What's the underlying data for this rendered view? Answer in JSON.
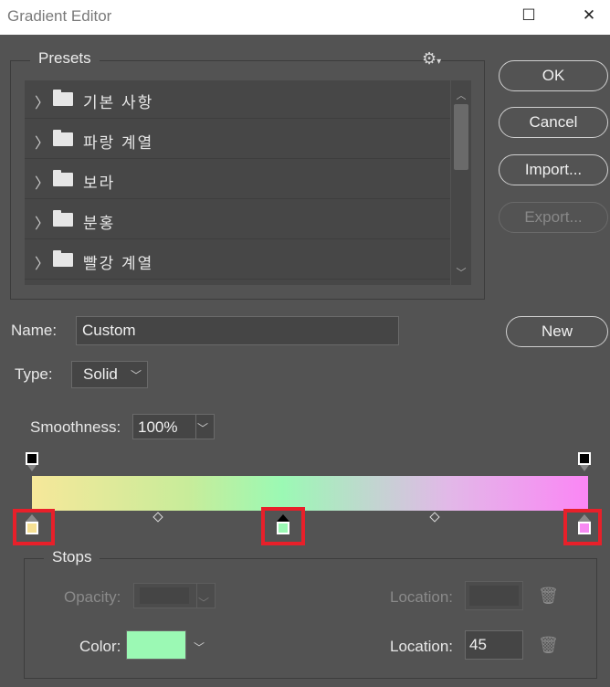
{
  "window": {
    "title": "Gradient Editor",
    "restore_glyph": "☐",
    "close_glyph": "✕"
  },
  "presets": {
    "label": "Presets",
    "gear_glyph": "⚙",
    "items": [
      {
        "label": "기본 사항"
      },
      {
        "label": "파랑 계열"
      },
      {
        "label": "보라"
      },
      {
        "label": "분홍"
      },
      {
        "label": "빨강 계열"
      }
    ]
  },
  "buttons": {
    "ok": "OK",
    "cancel": "Cancel",
    "import": "Import...",
    "export": "Export...",
    "new": "New"
  },
  "name": {
    "label": "Name:",
    "value": "Custom"
  },
  "type": {
    "label": "Type:",
    "value": "Solid"
  },
  "smoothness": {
    "label": "Smoothness:",
    "value": "100%"
  },
  "gradient": {
    "colors": [
      "#f6e89a",
      "#c8ec9a",
      "#9bf9b4",
      "#e2b8e8",
      "#fb86f5"
    ],
    "color_stops": [
      {
        "color": "#f6e093",
        "location": 0
      },
      {
        "color": "#9bf9b4",
        "location": 45,
        "selected": true
      },
      {
        "color": "#f78af2",
        "location": 100
      }
    ]
  },
  "stops": {
    "label": "Stops",
    "opacity_label": "Opacity:",
    "opacity_location_label": "Location:",
    "color_label": "Color:",
    "color_value": "#9bf9b4",
    "color_location_label": "Location:",
    "color_location_value": "45"
  }
}
